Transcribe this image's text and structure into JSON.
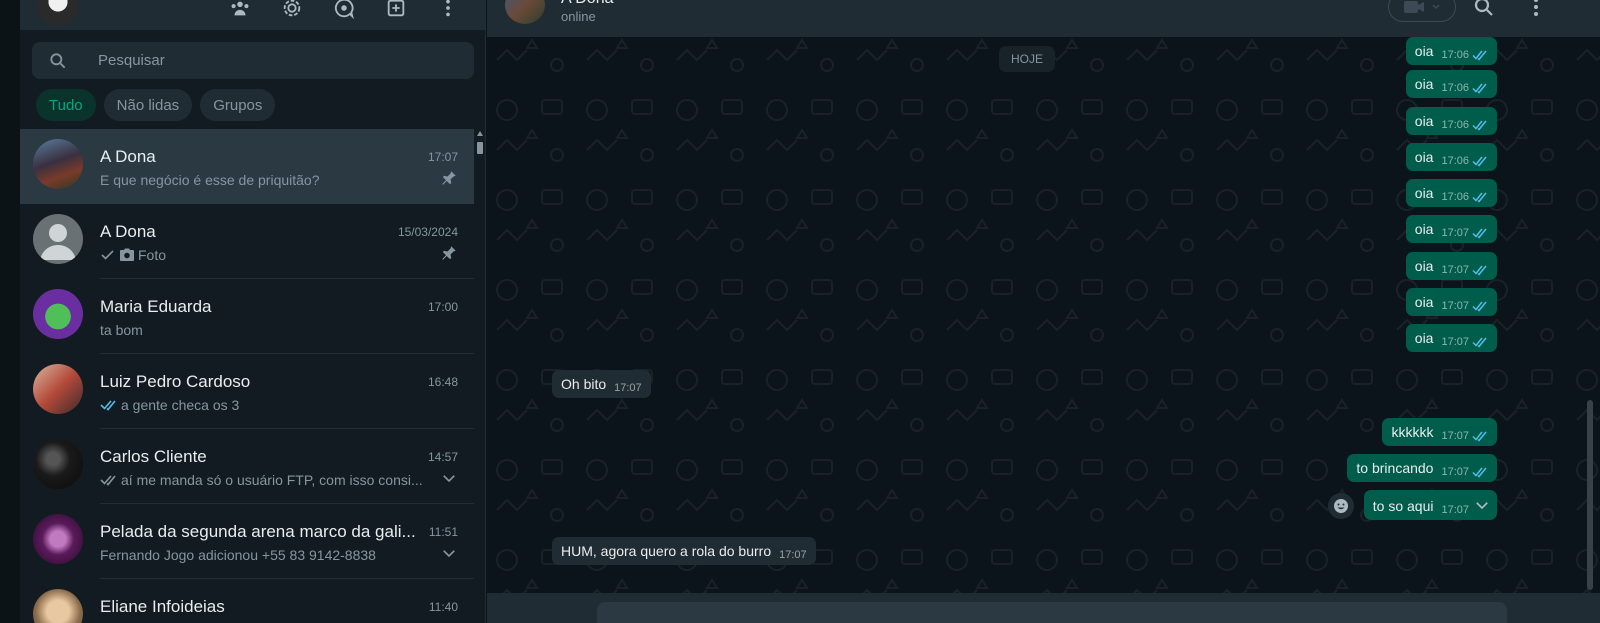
{
  "sidebar": {
    "search": {
      "placeholder": "Pesquisar"
    },
    "filters": [
      "Tudo",
      "Não lidas",
      "Grupos"
    ],
    "chats": [
      {
        "name": "A Dona",
        "time": "17:07",
        "preview": "E que negócio é esse de priquitão?",
        "pinned": true
      },
      {
        "name": "A Dona",
        "time": "15/03/2024",
        "preview": "Foto",
        "pinned": true
      },
      {
        "name": "Maria Eduarda",
        "time": "17:00",
        "preview": "ta bom"
      },
      {
        "name": "Luiz Pedro Cardoso",
        "time": "16:48",
        "preview": "a gente checa os 3"
      },
      {
        "name": "Carlos Cliente",
        "time": "14:57",
        "preview": "aí me manda só o usuário FTP,  com isso consi..."
      },
      {
        "name": "Pelada da segunda arena marco da gali...",
        "time": "11:51",
        "preview": "Fernando Jogo adicionou +55 83 9142-8838"
      },
      {
        "name": "Eliane Infoideias",
        "time": "11:40",
        "preview": ""
      }
    ]
  },
  "conversation": {
    "contact_name": "A Dona",
    "contact_status": "online",
    "date_label": "HOJE",
    "messages": [
      {
        "text": "oia",
        "time": "17:06"
      },
      {
        "text": "oia",
        "time": "17:06"
      },
      {
        "text": "oia",
        "time": "17:06"
      },
      {
        "text": "oia",
        "time": "17:06"
      },
      {
        "text": "oia",
        "time": "17:06"
      },
      {
        "text": "oia",
        "time": "17:07"
      },
      {
        "text": "oia",
        "time": "17:07"
      },
      {
        "text": "oia",
        "time": "17:07"
      },
      {
        "text": "oia",
        "time": "17:07"
      },
      {
        "text": "Oh bito",
        "time": "17:07"
      },
      {
        "text": "kkkkkk",
        "time": "17:07"
      },
      {
        "text": "to brincando",
        "time": "17:07"
      },
      {
        "text": "to so aqui",
        "time": "17:07"
      },
      {
        "text": "HUM, agora quero a rola do burro",
        "time": "17:07"
      }
    ]
  },
  "colors": {
    "accent": "#00a884",
    "outgoing": "#005c4b",
    "incoming": "#202c33",
    "read_ticks": "#53bdeb"
  }
}
